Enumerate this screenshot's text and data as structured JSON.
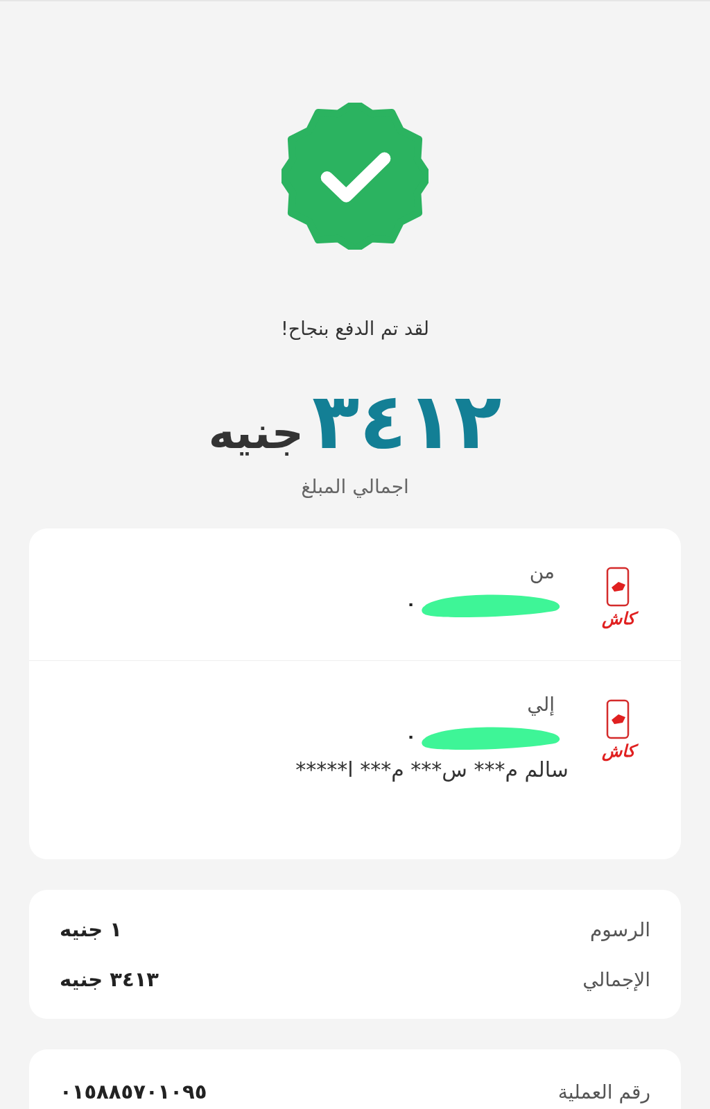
{
  "status": {
    "message": "لقد تم الدفع بنجاح!"
  },
  "amount": {
    "value": "٣٤١٢",
    "currency": "جنيه",
    "caption": "اجمالي المبلغ"
  },
  "parties": [
    {
      "label": "من",
      "logo_text": "كاش",
      "number_visible": "٠"
    },
    {
      "label": "إلي",
      "logo_text": "كاش",
      "number_visible": "٠",
      "name": "سالم م*** س*** م*** ا*****"
    }
  ],
  "fees": [
    {
      "label": "الرسوم",
      "value": "١ جنيه"
    },
    {
      "label": "الإجمالي",
      "value": "٣٤١٣ جنيه"
    }
  ],
  "transaction": {
    "label": "رقم العملية",
    "value": "٠١٥٨٨٥٧٠١٠٩٥"
  }
}
